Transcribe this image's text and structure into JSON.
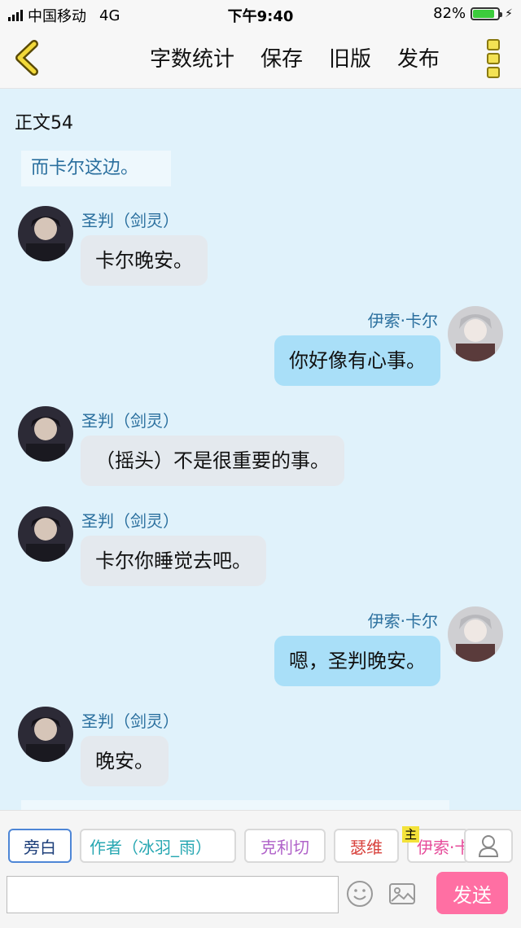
{
  "status_bar": {
    "carrier": "中国移动",
    "network": "4G",
    "time": "下午9:40",
    "battery_percent": "82%",
    "battery_level": 0.82
  },
  "nav": {
    "word_count": "字数统计",
    "save": "保存",
    "old_version": "旧版",
    "publish": "发布"
  },
  "chapter_title": "正文54",
  "narration": "而卡尔这边。",
  "messages": [
    {
      "speaker": "圣判（剑灵）",
      "text": "卡尔晚安。",
      "side": "left"
    },
    {
      "speaker": "伊索·卡尔",
      "text": "你好像有心事。",
      "side": "right"
    },
    {
      "speaker": "圣判（剑灵）",
      "text": "（摇头）不是很重要的事。",
      "side": "left"
    },
    {
      "speaker": "圣判（剑灵）",
      "text": "卡尔你睡觉去吧。",
      "side": "left"
    },
    {
      "speaker": "伊索·卡尔",
      "text": "嗯，圣判晚安。",
      "side": "right"
    },
    {
      "speaker": "圣判（剑灵）",
      "text": "晚安。",
      "side": "left"
    }
  ],
  "roles": [
    "旁白",
    "作者（冰羽_雨）",
    "克利切",
    "瑟维",
    "伊索·卡尔"
  ],
  "owner_badge": "主",
  "input": {
    "value": "",
    "placeholder": ""
  },
  "send_label": "发送",
  "colors": {
    "accent_send": "#ff6fa3",
    "chat_bg": "#e0f2fb",
    "right_bubble": "#a9dff8",
    "left_bubble": "#e4e9ee",
    "name_color": "#2a6f9e"
  }
}
